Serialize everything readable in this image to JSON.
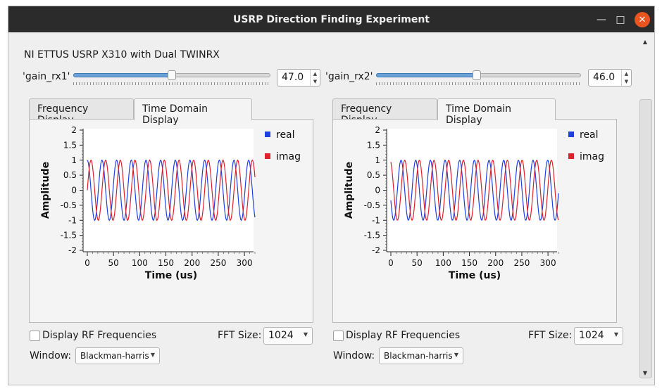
{
  "window": {
    "title": "USRP Direction Finding Experiment",
    "min_icon": "minimize-icon",
    "max_icon": "maximize-icon",
    "close_icon": "close-icon",
    "close_color": "#e95420"
  },
  "device_label": "NI ETTUS USRP X310 with Dual TWINRX",
  "gains": [
    {
      "label": "'gain_rx1'",
      "value": "47.0",
      "level_fraction": 0.5
    },
    {
      "label": "'gain_rx2'",
      "value": "46.0",
      "level_fraction": 0.49
    }
  ],
  "panels": [
    {
      "tabs": [
        "Frequency Display",
        "Time Domain Display"
      ],
      "active_tab": 1,
      "rf_checkbox_label": "Display RF Frequencies",
      "rf_checked": false,
      "fft_label": "FFT Size:",
      "fft_value": "1024",
      "window_label": "Window:",
      "window_value": "Blackman-harris",
      "chart_data": {
        "type": "line",
        "xlabel": "Time (us)",
        "ylabel": "Amplitude",
        "xlim": [
          0,
          320
        ],
        "ylim": [
          -2,
          2
        ],
        "xticks": [
          "0",
          "50",
          "100",
          "150",
          "200",
          "250",
          "300"
        ],
        "yticks": [
          "2",
          "1.5",
          "1",
          "0.5",
          "0",
          "-0.5",
          "-1",
          "-1.5",
          "-2"
        ],
        "grid": false,
        "legend_position": "top-right",
        "period_us": 28,
        "series": [
          {
            "name": "real",
            "color": "#1f3fe0",
            "amplitude": 1.0,
            "phase_deg": 90
          },
          {
            "name": "imag",
            "color": "#e0202a",
            "amplitude": 1.0,
            "phase_deg": 0
          }
        ]
      }
    },
    {
      "tabs": [
        "Frequency Display",
        "Time Domain Display"
      ],
      "active_tab": 1,
      "rf_checkbox_label": "Display RF Frequencies",
      "rf_checked": false,
      "fft_label": "FFT Size:",
      "fft_value": "1024",
      "window_label": "Window:",
      "window_value": "Blackman-harris",
      "chart_data": {
        "type": "line",
        "xlabel": "Time (us)",
        "ylabel": "Amplitude",
        "xlim": [
          0,
          320
        ],
        "ylim": [
          -2,
          2
        ],
        "xticks": [
          "0",
          "50",
          "100",
          "150",
          "200",
          "250",
          "300"
        ],
        "yticks": [
          "2",
          "1.5",
          "1",
          "0.5",
          "0",
          "-0.5",
          "-1",
          "-1.5",
          "-2"
        ],
        "grid": false,
        "legend_position": "top-right",
        "period_us": 28,
        "series": [
          {
            "name": "real",
            "color": "#1f3fe0",
            "amplitude": 1.0,
            "phase_deg": 200
          },
          {
            "name": "imag",
            "color": "#e0202a",
            "amplitude": 1.0,
            "phase_deg": 110
          }
        ]
      }
    }
  ],
  "scrollbar": {
    "up_icon": "scroll-up-icon",
    "down_icon": "scroll-down-icon"
  }
}
